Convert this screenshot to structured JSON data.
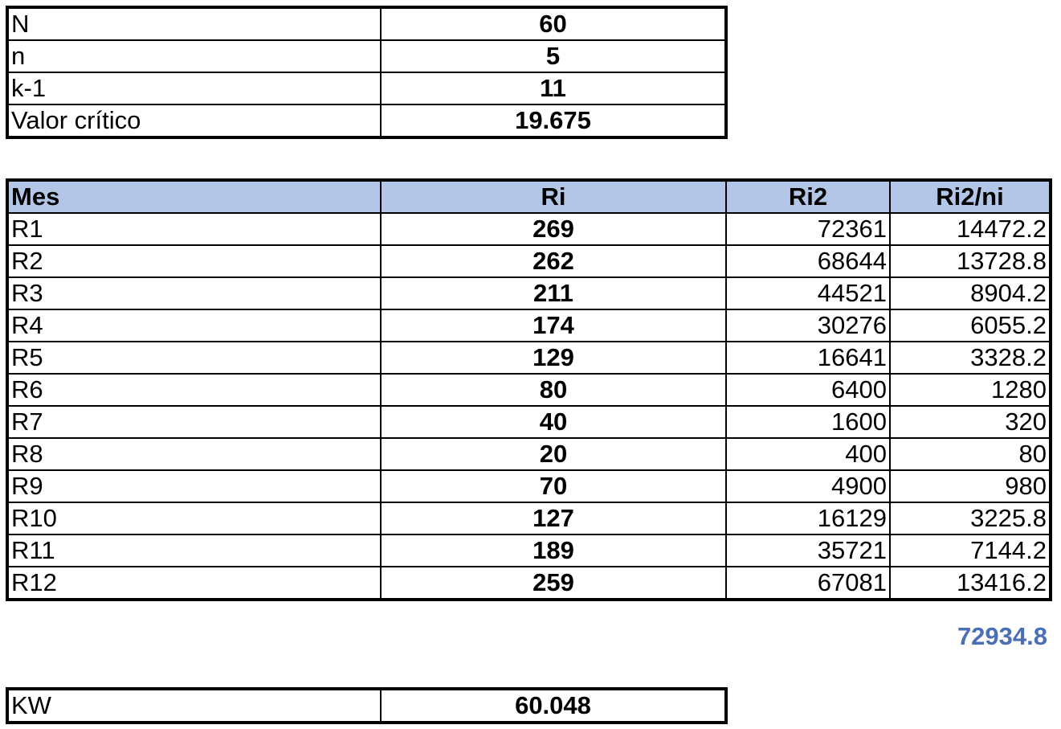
{
  "params": [
    {
      "label": "N",
      "value": "60"
    },
    {
      "label": "n",
      "value": "5"
    },
    {
      "label": "k-1",
      "value": "11"
    },
    {
      "label": "Valor crítico",
      "value": "19.675"
    }
  ],
  "ranks": {
    "headers": [
      "Mes",
      "Ri",
      "Ri2",
      "Ri2/ni"
    ],
    "rows": [
      {
        "mes": "R1",
        "ri": "269",
        "ri2": "72361",
        "ri2ni": "14472.2"
      },
      {
        "mes": "R2",
        "ri": "262",
        "ri2": "68644",
        "ri2ni": "13728.8"
      },
      {
        "mes": "R3",
        "ri": "211",
        "ri2": "44521",
        "ri2ni": "8904.2"
      },
      {
        "mes": "R4",
        "ri": "174",
        "ri2": "30276",
        "ri2ni": "6055.2"
      },
      {
        "mes": "R5",
        "ri": "129",
        "ri2": "16641",
        "ri2ni": "3328.2"
      },
      {
        "mes": "R6",
        "ri": "80",
        "ri2": "6400",
        "ri2ni": "1280"
      },
      {
        "mes": "R7",
        "ri": "40",
        "ri2": "1600",
        "ri2ni": "320"
      },
      {
        "mes": "R8",
        "ri": "20",
        "ri2": "400",
        "ri2ni": "80"
      },
      {
        "mes": "R9",
        "ri": "70",
        "ri2": "4900",
        "ri2ni": "980"
      },
      {
        "mes": "R10",
        "ri": "127",
        "ri2": "16129",
        "ri2ni": "3225.8"
      },
      {
        "mes": "R11",
        "ri": "189",
        "ri2": "35721",
        "ri2ni": "7144.2"
      },
      {
        "mes": "R12",
        "ri": "259",
        "ri2": "67081",
        "ri2ni": "13416.2"
      }
    ],
    "total": "72934.8"
  },
  "kw": {
    "label": "KW",
    "value": "60.048"
  },
  "colors": {
    "header_fill": "#b3c6e7",
    "total_text": "#4a6fb5"
  }
}
